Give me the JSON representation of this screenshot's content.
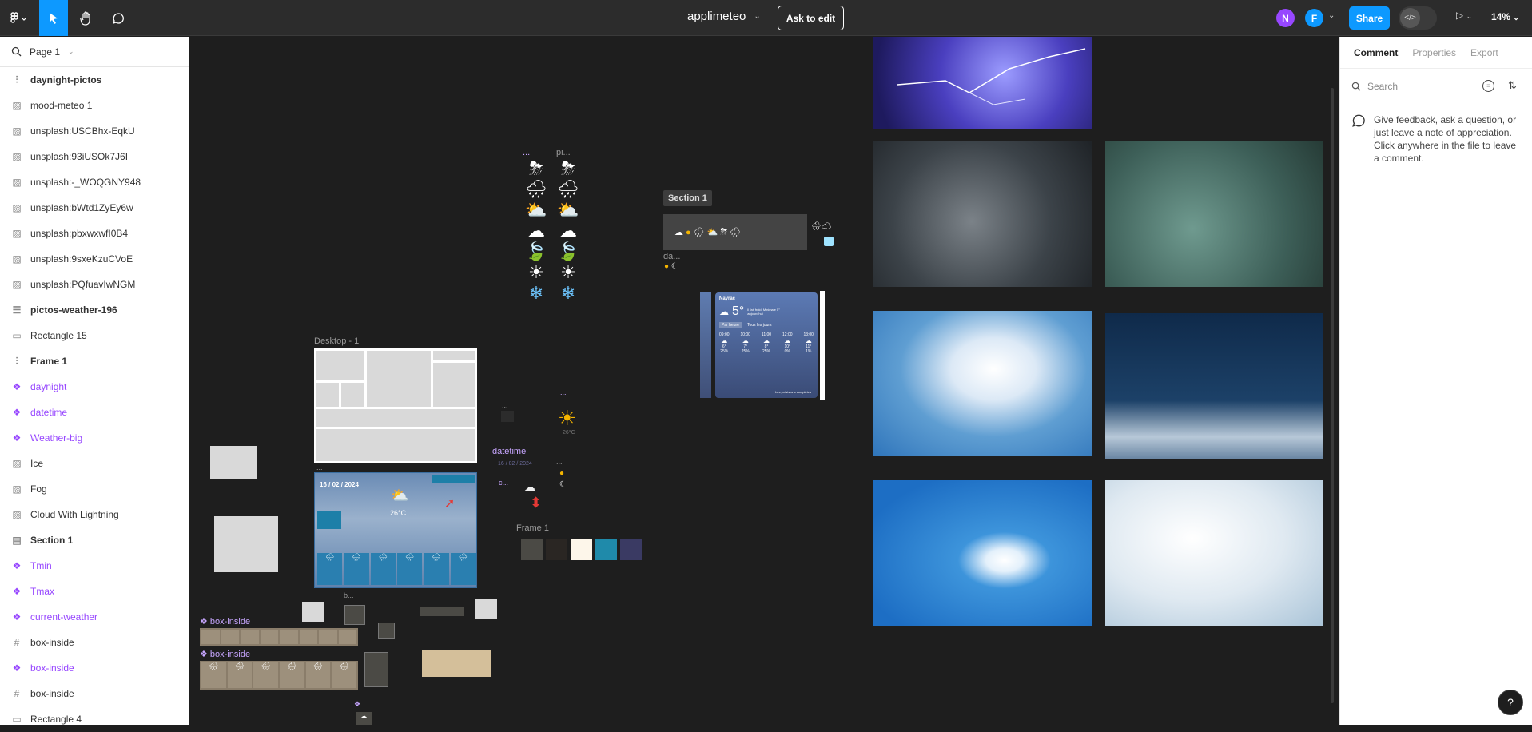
{
  "toolbar": {
    "file_name": "applimeteo",
    "ask_to_edit": "Ask to edit",
    "share": "Share",
    "zoom": "14%",
    "avatars": [
      "N",
      "F"
    ]
  },
  "left_panel": {
    "page": "Page 1",
    "layers": [
      {
        "name": "daynight-pictos",
        "icon": "frame-icon",
        "type": "bold"
      },
      {
        "name": "mood-meteo 1",
        "icon": "image-icon",
        "type": "normal"
      },
      {
        "name": "unsplash:USCBhx-EqkU",
        "icon": "image-icon",
        "type": "normal"
      },
      {
        "name": "unsplash:93iUSOk7J6I",
        "icon": "image-icon",
        "type": "normal"
      },
      {
        "name": "unsplash:-_WOQGNY948",
        "icon": "image-icon",
        "type": "normal"
      },
      {
        "name": "unsplash:bWtd1ZyEy6w",
        "icon": "image-icon",
        "type": "normal"
      },
      {
        "name": "unsplash:pbxwxwfI0B4",
        "icon": "image-icon",
        "type": "normal"
      },
      {
        "name": "unsplash:9sxeKzuCVoE",
        "icon": "image-icon",
        "type": "normal"
      },
      {
        "name": "unsplash:PQfuavIwNGM",
        "icon": "image-icon",
        "type": "normal"
      },
      {
        "name": "pictos-weather-196",
        "icon": "list-icon",
        "type": "bold"
      },
      {
        "name": "Rectangle 15",
        "icon": "rectangle-icon",
        "type": "normal"
      },
      {
        "name": "Frame 1",
        "icon": "frame-icon",
        "type": "bold"
      },
      {
        "name": "daynight",
        "icon": "component-icon",
        "type": "comp"
      },
      {
        "name": "datetime",
        "icon": "component-icon",
        "type": "comp"
      },
      {
        "name": "Weather-big",
        "icon": "component-icon",
        "type": "comp"
      },
      {
        "name": "Ice",
        "icon": "image-icon",
        "type": "normal"
      },
      {
        "name": "Fog",
        "icon": "image-icon",
        "type": "normal"
      },
      {
        "name": "Cloud With Lightning",
        "icon": "image-icon",
        "type": "normal"
      },
      {
        "name": "Section 1",
        "icon": "section-icon",
        "type": "bold"
      },
      {
        "name": "Tmin",
        "icon": "component-icon",
        "type": "comp"
      },
      {
        "name": "Tmax",
        "icon": "component-icon",
        "type": "comp"
      },
      {
        "name": "current-weather",
        "icon": "component-icon",
        "type": "comp"
      },
      {
        "name": "box-inside",
        "icon": "grid-icon",
        "type": "normal"
      },
      {
        "name": "box-inside",
        "icon": "component-icon",
        "type": "comp"
      },
      {
        "name": "box-inside",
        "icon": "grid-icon",
        "type": "normal"
      },
      {
        "name": "Rectangle 4",
        "icon": "rectangle-icon",
        "type": "normal"
      }
    ]
  },
  "canvas": {
    "section_label": "Section 1",
    "desktop_label": "Desktop - 1",
    "datetime_label": "datetime",
    "frame1_label": "Frame 1",
    "box_inside_1": "box-inside",
    "box_inside_2": "box-inside",
    "small_labels": {
      "pictos_a": "...",
      "pictos_b": "pi...",
      "da": "da...",
      "c": "c...",
      "b": "b...",
      "dots1": "...",
      "dots2": "...",
      "dots3": "...",
      "dots4": "...",
      "dots5": "..."
    },
    "desktop_date": "16 / 02 / 2024",
    "desktop_temp": "26°C",
    "datetime_date": "16 / 02 / 2024",
    "mini_temp": "26°C",
    "phone": {
      "city": "Nayrac",
      "temp": "5°",
      "note": "Il fait froid. Minimale 5° aujourd'hui",
      "tab_now": "Par heure",
      "tab_days": "Tous les jours",
      "hours": [
        "09:00",
        "10:00",
        "11:00",
        "12:00",
        "13:00"
      ],
      "temps": [
        "6°",
        "7°",
        "8°",
        "10°",
        "11°"
      ],
      "rain": [
        "25%",
        "25%",
        "25%",
        "0%",
        "1%"
      ],
      "footer": "Les prévisions complètes"
    },
    "swatches": [
      "#4b4a45",
      "#2a2623",
      "#fdf6ea",
      "#1f8aaa",
      "#3a3a63"
    ]
  },
  "right_panel": {
    "tabs": [
      "Comment",
      "Properties",
      "Export"
    ],
    "active_tab": "Comment",
    "search_placeholder": "Search",
    "hint": "Give feedback, ask a question, or just leave a note of appreciation. Click anywhere in the file to leave a comment."
  },
  "help": "?"
}
